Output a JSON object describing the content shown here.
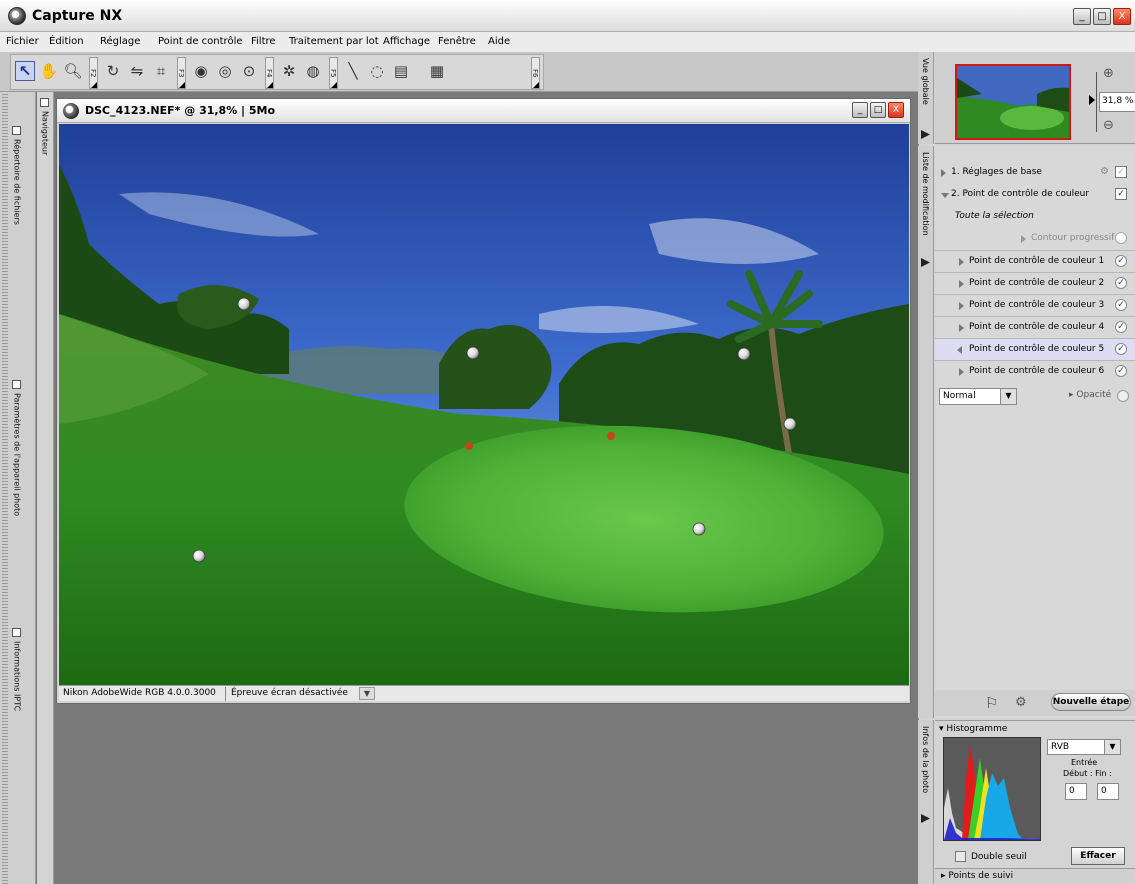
{
  "app": {
    "title": "Capture NX"
  },
  "window_controls": {
    "minimize": "_",
    "maximize": "□",
    "close": "X"
  },
  "menu": [
    "Fichier",
    "Édition",
    "Réglage",
    "Point de contrôle",
    "Filtre",
    "Traitement par lot",
    "Affichage",
    "Fenêtre",
    "Aide"
  ],
  "toolbar": {
    "fkeys": [
      "F2",
      "F3",
      "F4",
      "F5",
      "F6"
    ]
  },
  "left_panels": {
    "files": "Répertoire de fichiers",
    "camera": "Paramètres de l'appareil photo",
    "iptc": "Informations IPTC",
    "navigator": "Navigateur"
  },
  "image_window": {
    "title": "DSC_4123.NEF* @ 31,8% | 5Mo",
    "status_profile": "Nikon AdobeWide RGB 4.0.0.3000",
    "status_proof": "Épreuve écran désactivée"
  },
  "global_view": {
    "label": "Vue globale",
    "zoom": "31,8 %"
  },
  "edit_list": {
    "label": "Liste de modification",
    "step1": "1. Réglages de base",
    "step2": "2. Point de contrôle de couleur",
    "selection": "Toute la sélection",
    "contour": "Contour progressif",
    "control_points": [
      "Point de contrôle de couleur 1",
      "Point de contrôle de couleur 2",
      "Point de contrôle de couleur 3",
      "Point de contrôle de couleur 4",
      "Point de contrôle de couleur 5",
      "Point de contrôle de couleur 6"
    ],
    "blend_mode": "Normal",
    "opacity": "Opacité",
    "new_step": "Nouvelle étape"
  },
  "photo_info": {
    "label": "Infos de la photo",
    "histogram_title": "Histogramme",
    "channel": "RVB",
    "entree": "Entrée",
    "debut_fin": "Début : Fin :",
    "start": "0",
    "end": "0",
    "double_threshold": "Double seuil",
    "clear": "Effacer",
    "tracking_points": "Points de suivi"
  },
  "colors": {
    "selected_row": "#dcdcf2",
    "thumb_border": "#d01818",
    "check": "#1b2fb0"
  }
}
